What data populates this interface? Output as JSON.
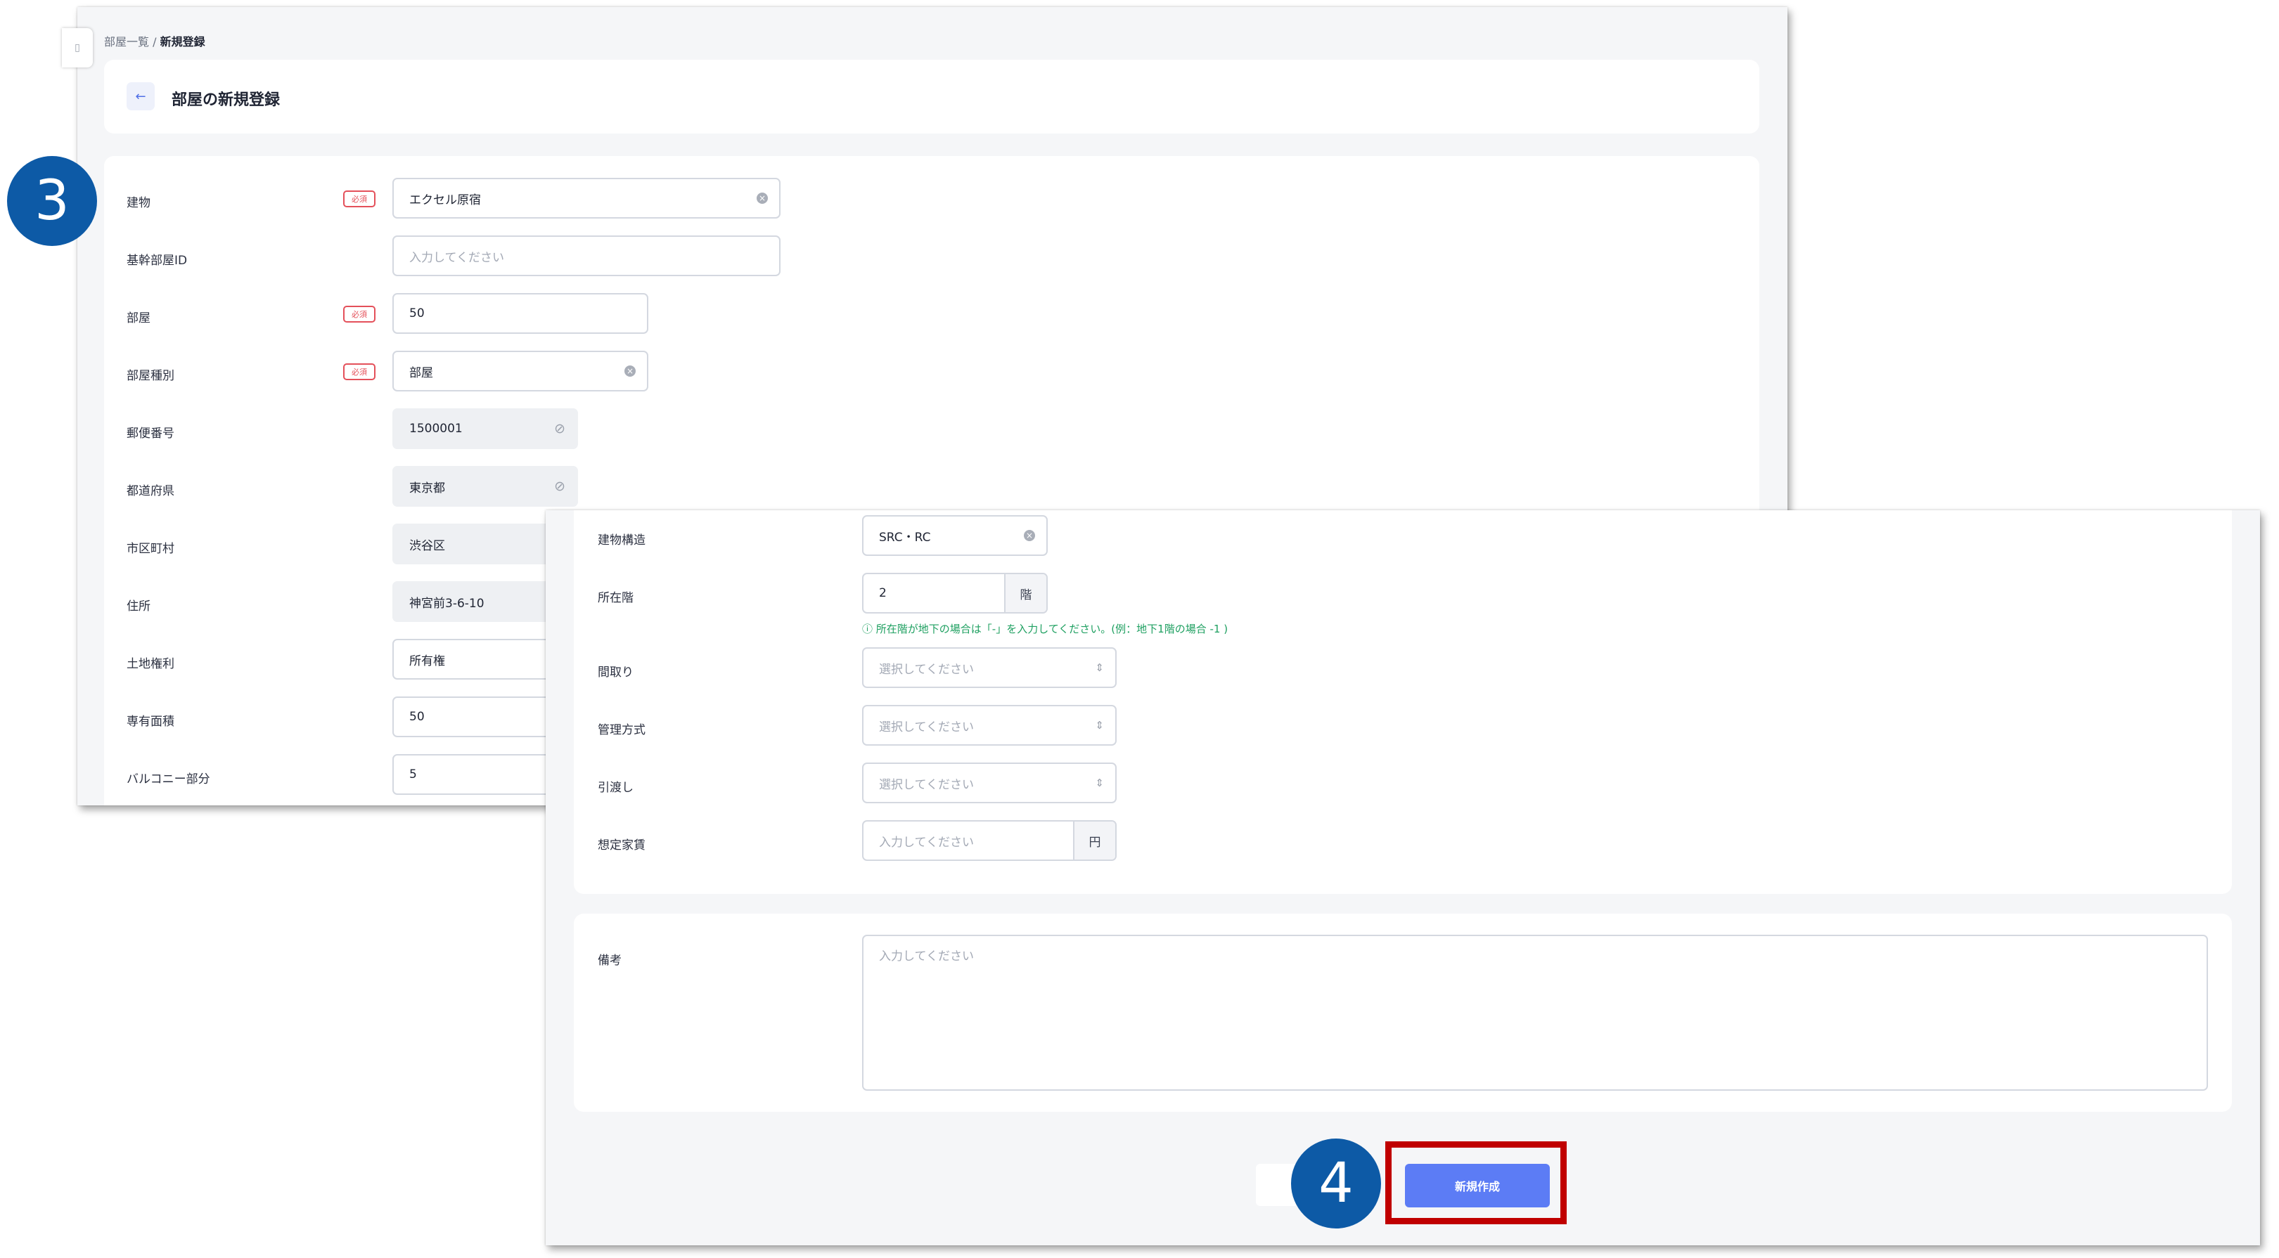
{
  "breadcrumb": {
    "parent": "部屋一覧",
    "separator": "/",
    "current": "新規登録"
  },
  "page_title": "部屋の新規登録",
  "back_icon": "←",
  "required_badge": "必須",
  "form_top": {
    "building": {
      "label": "建物",
      "value": "エクセル原宿"
    },
    "core_room_id": {
      "label": "基幹部屋ID",
      "placeholder": "入力してください"
    },
    "room": {
      "label": "部屋",
      "value": "50"
    },
    "room_type": {
      "label": "部屋種別",
      "value": "部屋"
    },
    "postal_code": {
      "label": "郵便番号",
      "value": "1500001"
    },
    "prefecture": {
      "label": "都道府県",
      "value": "東京都"
    },
    "city": {
      "label": "市区町村",
      "value": "渋谷区"
    },
    "address": {
      "label": "住所",
      "value": "神宮前3-6-10"
    },
    "land_rights": {
      "label": "土地権利",
      "value": "所有権"
    },
    "exclusive_area": {
      "label": "専有面積",
      "value": "50"
    },
    "balcony": {
      "label": "バルコニー部分",
      "value": "5"
    }
  },
  "form_bottom": {
    "structure": {
      "label": "建物構造",
      "value": "SRC・RC"
    },
    "floor": {
      "label": "所在階",
      "value": "2",
      "unit": "階",
      "hint": "所在階が地下の場合は「-」を入力してください。(例：地下1階の場合 -1 )"
    },
    "layout": {
      "label": "間取り",
      "placeholder": "選択してください"
    },
    "management": {
      "label": "管理方式",
      "placeholder": "選択してください"
    },
    "handover": {
      "label": "引渡し",
      "placeholder": "選択してください"
    },
    "rent": {
      "label": "想定家賃",
      "placeholder": "入力してください",
      "unit": "円"
    },
    "remarks": {
      "label": "備考",
      "placeholder": "入力してください"
    }
  },
  "submit_label": "新規作成",
  "callouts": {
    "step3": "3",
    "step4": "4"
  },
  "colors": {
    "primary": "#5c7cf5",
    "required": "#e4505a",
    "callout": "#0d5aa6",
    "highlight": "#c00000",
    "hint": "#1fa061"
  }
}
